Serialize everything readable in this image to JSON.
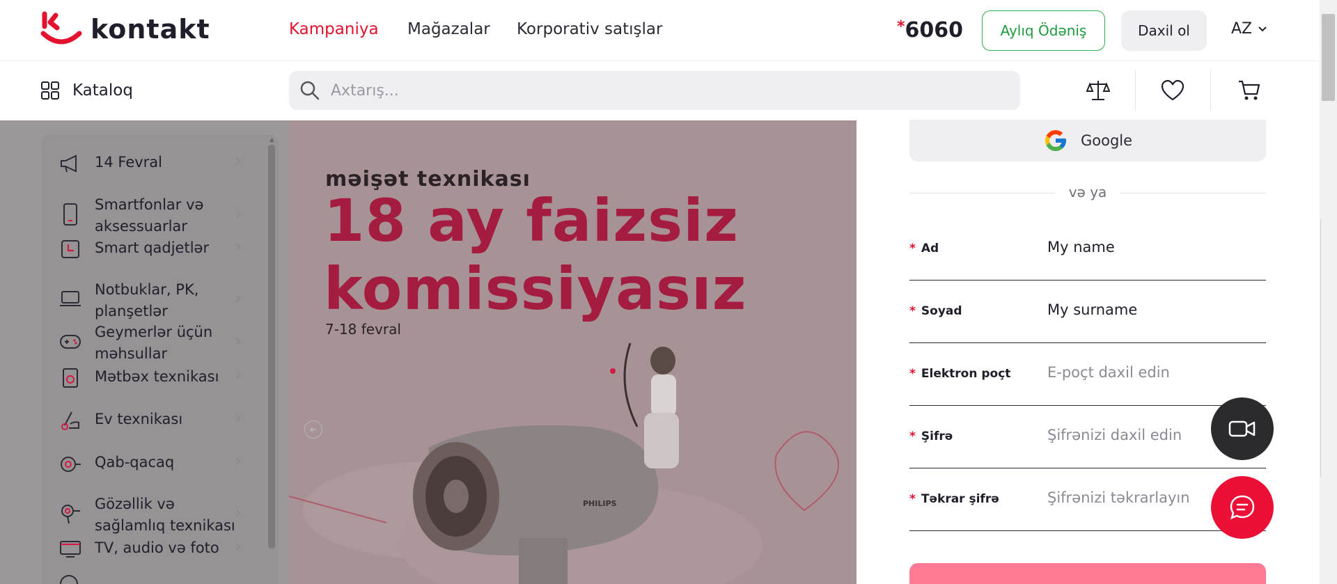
{
  "header": {
    "logo_text": "kontakt",
    "nav": [
      "Kampaniya",
      "Mağazalar",
      "Korporativ satışlar"
    ],
    "phone_star": "*",
    "phone": "6060",
    "monthly_button": "Aylıq Ödəniş",
    "login_button": "Daxil ol",
    "language": "AZ"
  },
  "subheader": {
    "catalog_label": "Kataloq",
    "search_placeholder": "Axtarış..."
  },
  "sidebar": {
    "items": [
      {
        "label": "14 Fevral",
        "icon": "megaphone-icon"
      },
      {
        "label": "Smartfonlar və aksessuarlar",
        "icon": "smartphone-icon"
      },
      {
        "label": "Smart qadjetlər",
        "icon": "smartwatch-icon"
      },
      {
        "label": "Notbuklar, PK, planşetlər",
        "icon": "laptop-icon"
      },
      {
        "label": "Geymerlər üçün məhsullar",
        "icon": "gamepad-icon"
      },
      {
        "label": "Mətbəx texnikası",
        "icon": "oven-icon"
      },
      {
        "label": "Ev texnikası",
        "icon": "vacuum-icon"
      },
      {
        "label": "Qab-qacaq",
        "icon": "cookware-icon"
      },
      {
        "label": "Gözəllik və sağlamlıq texnikası",
        "icon": "hairdryer-icon"
      },
      {
        "label": "TV, audio və foto",
        "icon": "tv-icon"
      }
    ]
  },
  "banner": {
    "subtitle": "məişət texnikası",
    "title_line1": "18 ay faizsiz",
    "title_line2": "komissiyasız",
    "dates": "7-18 fevral",
    "product_brand": "PHILIPS"
  },
  "form": {
    "google_label": "Google",
    "or_text": "və ya",
    "fields": [
      {
        "label": "Ad",
        "value": "My name",
        "placeholder": ""
      },
      {
        "label": "Soyad",
        "value": "My surname",
        "placeholder": ""
      },
      {
        "label": "Elektron poçt",
        "value": "",
        "placeholder": "E-poçt daxil edin"
      },
      {
        "label": "Şifrə",
        "value": "",
        "placeholder": "Şifrənizi daxil edin"
      },
      {
        "label": "Təkrar şifrə",
        "value": "",
        "placeholder": "Şifrənizi təkrarlayın"
      }
    ],
    "required_mark": "*"
  },
  "colors": {
    "brand_red": "#e3122f",
    "accent_green": "#2fae4e",
    "banner_title": "#a51c41",
    "chat_button": "#ec1036"
  }
}
